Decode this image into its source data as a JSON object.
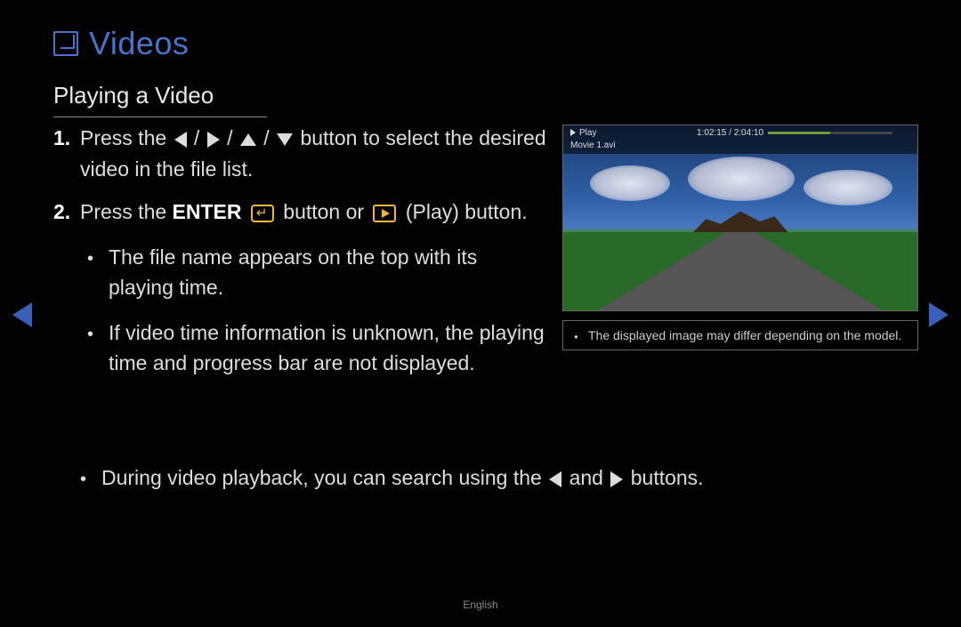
{
  "title": "Videos",
  "subtitle": "Playing a Video",
  "step1_a": "Press the ",
  "step1_b": " button to select the desired video in the file list.",
  "step2_a": "Press the ",
  "step2_enter": "ENTER",
  "step2_b": " button or ",
  "step2_c": " (Play) button.",
  "bullet1": "The file name appears on the top with its playing time.",
  "bullet2": "If video time information is unknown, the playing time and progress bar are not displayed.",
  "bullet3_a": "During video playback, you can search using the ",
  "bullet3_b": " and ",
  "bullet3_c": " buttons.",
  "note": "The displayed image may differ depending on the model.",
  "preview": {
    "play_label": "Play",
    "time": "1:02:15 / 2:04:10",
    "filename": "Movie 1.avi"
  },
  "footer": "English",
  "slash": " / "
}
